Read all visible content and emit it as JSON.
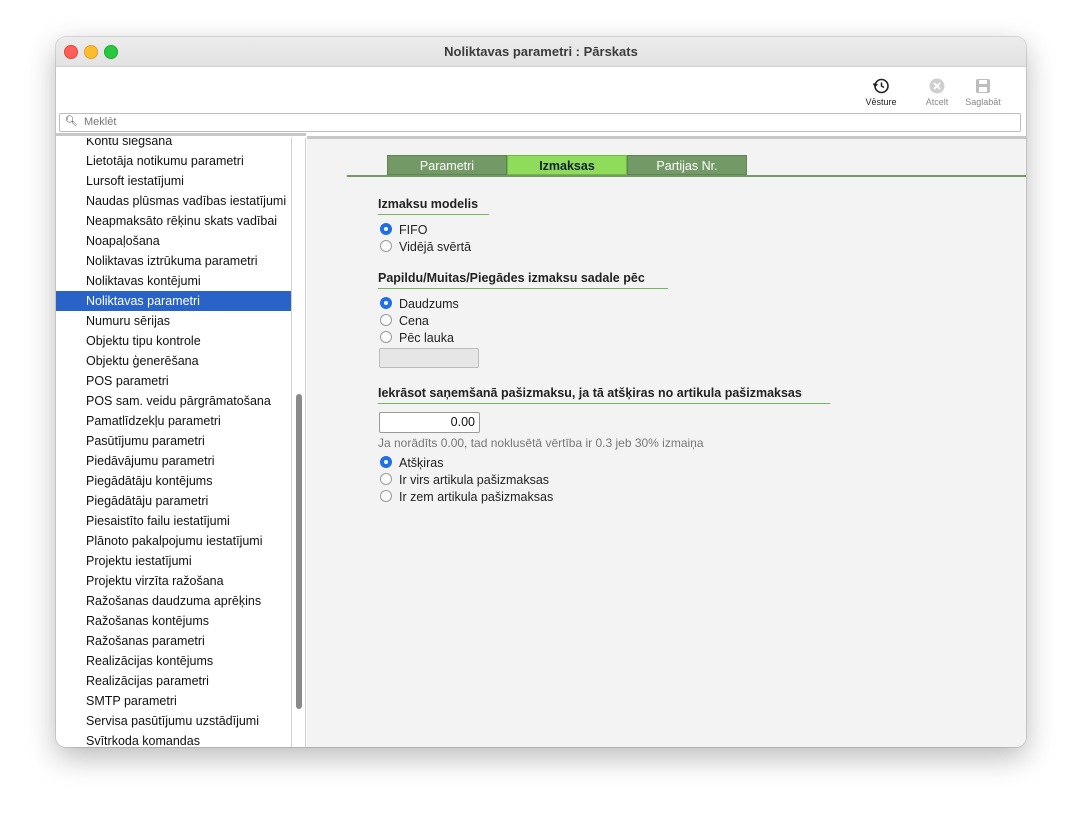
{
  "window": {
    "title": "Noliktavas parametri : Pārskats"
  },
  "toolbar": {
    "history_label": "Vēsture",
    "cancel_label": "Atcelt",
    "save_label": "Saglabāt"
  },
  "search": {
    "placeholder": "Meklēt"
  },
  "sidebar": {
    "items": [
      "Kontu slēgšana",
      "Lietotāja notikumu parametri",
      "Lursoft iestatījumi",
      "Naudas plūsmas vadības iestatījumi",
      "Neapmaksāto rēķinu skats vadībai",
      "Noapaļošana",
      "Noliktavas iztrūkuma parametri",
      "Noliktavas kontējumi",
      "Noliktavas parametri",
      "Numuru sērijas",
      "Objektu tipu kontrole",
      "Objektu ģenerēšana",
      "POS parametri",
      "POS sam. veidu pārgrāmatošana",
      "Pamatlīdzekļu parametri",
      "Pasūtījumu parametri",
      "Piedāvājumu parametri",
      "Piegādātāju kontējums",
      "Piegādātāju parametri",
      "Piesaistīto failu iestatījumi",
      "Plānoto pakalpojumu iestatījumi",
      "Projektu iestatījumi",
      "Projektu virzīta ražošana",
      "Ražošanas daudzuma aprēķins",
      "Ražošanas kontējums",
      "Ražošanas parametri",
      "Realizācijas kontējums",
      "Realizācijas parametri",
      "SMTP parametri",
      "Servisa pasūtījumu uzstādījumi",
      "Svītrkoda komandas"
    ],
    "selected_index": 8
  },
  "tabs": [
    "Parametri",
    "Izmaksas",
    "Partijas Nr."
  ],
  "active_tab": 1,
  "cost_model": {
    "heading": "Izmaksu modelis",
    "options": [
      "FIFO",
      "Vidējā svērtā"
    ],
    "selected": 0
  },
  "distribution": {
    "heading": "Papildu/Muitas/Piegādes izmaksu sadale pēc",
    "options": [
      "Daudzums",
      "Cena",
      "Pēc lauka"
    ],
    "selected": 0,
    "field_value": ""
  },
  "receipt_cost": {
    "heading": "Iekrāsot saņemšanā pašizmaksu, ja tā atšķiras no artikula pašizmaksas",
    "value": "0.00",
    "hint": "Ja norādīts 0.00, tad noklusētā vērtība ir 0.3 jeb 30% izmaiņa",
    "options": [
      "Atšķiras",
      "Ir virs artikula pašizmaksas",
      "Ir zem artikula pašizmaksas"
    ],
    "selected": 0
  }
}
